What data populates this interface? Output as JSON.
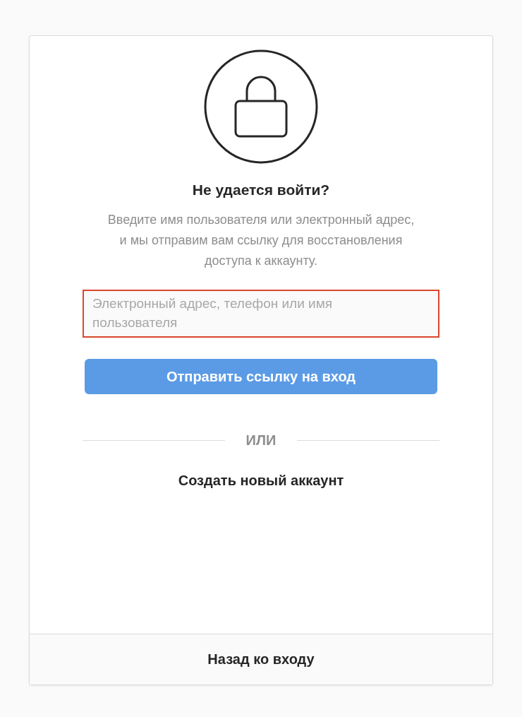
{
  "title": "Не удается войти?",
  "description": "Введите имя пользователя или электронный адрес, и мы отправим вам ссылку для восстановления доступа к аккаунту.",
  "login_field": {
    "placeholder": "Электронный адрес, телефон или имя пользователя",
    "highlighted": true
  },
  "send_button": {
    "label": "Отправить ссылку на вход",
    "disabled": true
  },
  "divider": "ИЛИ",
  "create_account_link": "Создать новый аккаунт",
  "back_button": "Назад ко входу"
}
